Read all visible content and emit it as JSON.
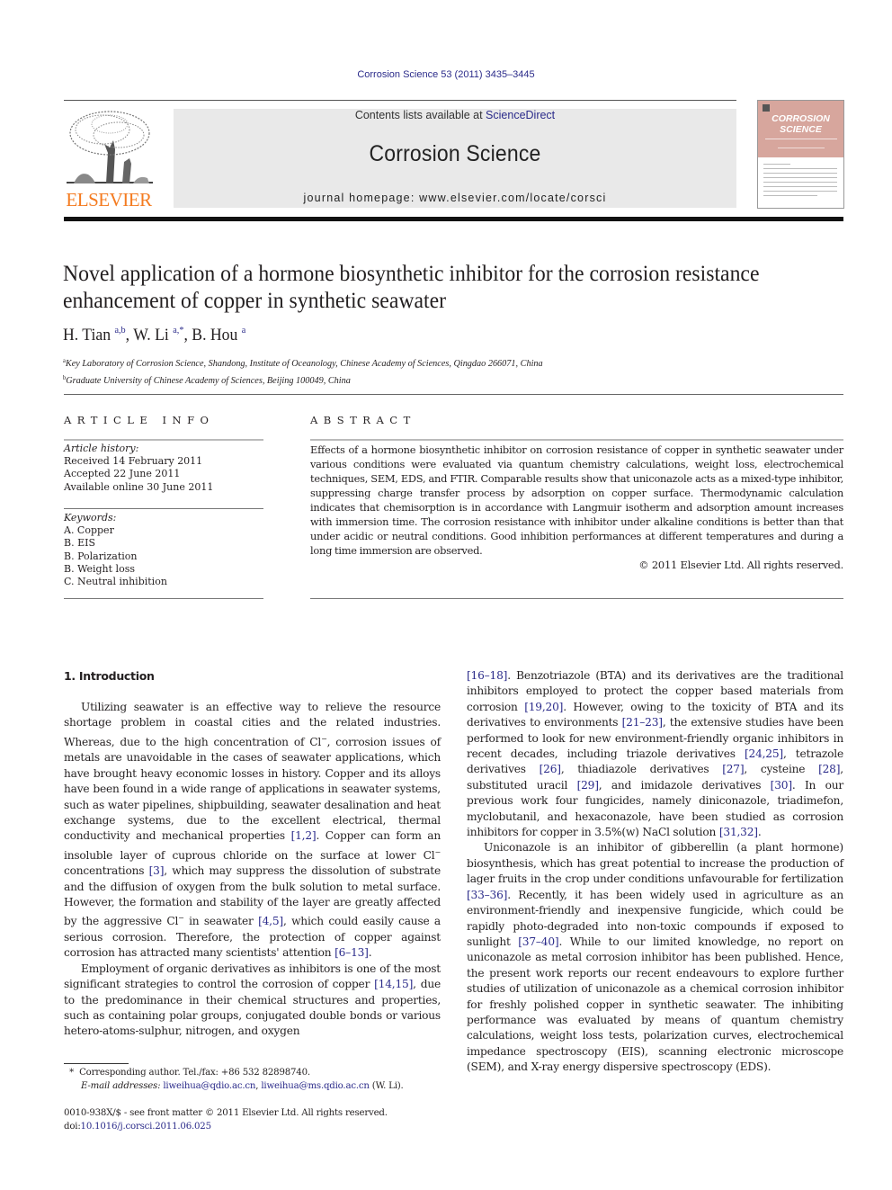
{
  "header": {
    "journal_reference": "Corrosion Science 53 (2011) 3435–3445",
    "contents_prefix": "Contents lists available at ",
    "contents_link": "ScienceDirect",
    "journal_title": "Corrosion Science",
    "homepage_prefix": "journal homepage: ",
    "homepage_url": "www.elsevier.com/locate/corsci",
    "publisher_wordmark": "ELSEVIER",
    "cover_title_line1": "CORROSION",
    "cover_title_line2": "SCIENCE",
    "colors": {
      "link": "#2b2b8a",
      "elsevier_orange": "#f47b20",
      "cover_pink": "#d7a69d",
      "masthead_gray": "#e9e9e9"
    }
  },
  "article": {
    "title": "Novel application of a hormone biosynthetic inhibitor for the corrosion resistance enhancement of copper in synthetic seawater",
    "authors": [
      {
        "name": "H. Tian",
        "sup": "a,b",
        "sep": ", "
      },
      {
        "name": "W. Li",
        "sup": "a,*",
        "sep": ", "
      },
      {
        "name": "B. Hou",
        "sup": "a",
        "sep": ""
      }
    ],
    "affiliations": [
      {
        "mark": "a",
        "text": "Key Laboratory of Corrosion Science, Shandong, Institute of Oceanology, Chinese Academy of Sciences, Qingdao 266071, China"
      },
      {
        "mark": "b",
        "text": "Graduate University of Chinese Academy of Sciences, Beijing 100049, China"
      }
    ]
  },
  "article_info": {
    "heading": "ARTICLE INFO",
    "history_label": "Article history:",
    "history": [
      "Received 14 February 2011",
      "Accepted 22 June 2011",
      "Available online 30 June 2011"
    ],
    "keywords_label": "Keywords:",
    "keywords": [
      "A. Copper",
      "B. EIS",
      "B. Polarization",
      "B. Weight loss",
      "C. Neutral inhibition"
    ]
  },
  "abstract": {
    "heading": "ABSTRACT",
    "text": "Effects of a hormone biosynthetic inhibitor on corrosion resistance of copper in synthetic seawater under various conditions were evaluated via quantum chemistry calculations, weight loss, electrochemical techniques, SEM, EDS, and FTIR. Comparable results show that uniconazole acts as a mixed-type inhibitor, suppressing charge transfer process by adsorption on copper surface. Thermodynamic calculation indicates that chemisorption is in accordance with Langmuir isotherm and adsorption amount increases with immersion time. The corrosion resistance with inhibitor under alkaline conditions is better than that under acidic or neutral conditions. Good inhibition performances at different temperatures and during a long time immersion are observed.",
    "copyright": "© 2011 Elsevier Ltd. All rights reserved."
  },
  "body": {
    "section_heading": "1. Introduction",
    "left_paragraphs": [
      [
        {
          "t": "Utilizing seawater is an effective way to relieve the resource shortage problem in coastal cities and the related industries. Whereas, due to the high concentration of Cl"
        },
        {
          "sup": "−"
        },
        {
          "t": ", corrosion issues of metals are unavoidable in the cases of seawater applications, which have brought heavy economic losses in history. Copper and its alloys have been found in a wide range of applications in seawater systems, such as water pipelines, shipbuilding, seawater desalination and heat exchange systems, due to the excellent electrical, thermal conductivity and mechanical properties "
        },
        {
          "cite": "[1,2]"
        },
        {
          "t": ". Copper can form an insoluble layer of cuprous chloride on the surface at lower Cl"
        },
        {
          "sup": "−"
        },
        {
          "t": " concentrations "
        },
        {
          "cite": "[3]"
        },
        {
          "t": ", which may suppress the dissolution of substrate and the diffusion of oxygen from the bulk solution to metal surface. However, the formation and stability of the layer are greatly affected by the aggressive Cl"
        },
        {
          "sup": "−"
        },
        {
          "t": " in seawater "
        },
        {
          "cite": "[4,5]"
        },
        {
          "t": ", which could easily cause a serious corrosion. Therefore, the protection of copper against corrosion has attracted many scientists' attention "
        },
        {
          "cite": "[6–13]"
        },
        {
          "t": "."
        }
      ],
      [
        {
          "t": "Employment of organic derivatives as inhibitors is one of the most significant strategies to control the corrosion of copper "
        },
        {
          "cite": "[14,15]"
        },
        {
          "t": ", due to the predominance in their chemical structures and properties, such as containing polar groups, conjugated double bonds or various hetero-atoms-sulphur, nitrogen, and oxygen"
        }
      ]
    ],
    "right_paragraphs": [
      [
        {
          "cite": "[16–18]"
        },
        {
          "t": ". Benzotriazole (BTA) and its derivatives are the traditional inhibitors employed to protect the copper based materials from corrosion "
        },
        {
          "cite": "[19,20]"
        },
        {
          "t": ". However, owing to the toxicity of BTA and its derivatives to environments "
        },
        {
          "cite": "[21–23]"
        },
        {
          "t": ", the extensive studies have been performed to look for new environment-friendly organic inhibitors in recent decades, including triazole derivatives "
        },
        {
          "cite": "[24,25]"
        },
        {
          "t": ", tetrazole derivatives "
        },
        {
          "cite": "[26]"
        },
        {
          "t": ", thiadiazole derivatives "
        },
        {
          "cite": "[27]"
        },
        {
          "t": ", cysteine "
        },
        {
          "cite": "[28]"
        },
        {
          "t": ", substituted uracil "
        },
        {
          "cite": "[29]"
        },
        {
          "t": ", and imidazole derivatives "
        },
        {
          "cite": "[30]"
        },
        {
          "t": ". In our previous work four fungicides, namely diniconazole, triadimefon, myclobutanil, and hexaconazole, have been studied as corrosion inhibitors for copper in 3.5%(w) NaCl solution "
        },
        {
          "cite": "[31,32]"
        },
        {
          "t": "."
        }
      ],
      [
        {
          "t": "Uniconazole is an inhibitor of gibberellin (a plant hormone) biosynthesis, which has great potential to increase the production of lager fruits in the crop under conditions unfavourable for fertilization "
        },
        {
          "cite": "[33–36]"
        },
        {
          "t": ". Recently, it has been widely used in agriculture as an environment-friendly and inexpensive fungicide, which could be rapidly photo-degraded into non-toxic compounds if exposed to sunlight "
        },
        {
          "cite": "[37–40]"
        },
        {
          "t": ". While to our limited knowledge, no report on uniconazole as metal corrosion inhibitor has been published. Hence, the present work reports our recent endeavours to explore further studies of utilization of uniconazole as a chemical corrosion inhibitor for freshly polished copper in synthetic seawater. The inhibiting performance was evaluated by means of quantum chemistry calculations, weight loss tests, polarization curves, electrochemical impedance spectroscopy (EIS), scanning electronic microscope (SEM), and X-ray energy dispersive spectroscopy (EDS)."
        }
      ]
    ]
  },
  "footnotes": {
    "corresponding": "Corresponding author. Tel./fax: +86 532 82898740.",
    "email_label": "E-mail addresses:",
    "email_1": "liweihua@qdio.ac.cn",
    "email_2": "liweihua@ms.qdio.ac.cn",
    "email_suffix": " (W. Li).",
    "issn_line": "0010-938X/$ - see front matter © 2011 Elsevier Ltd. All rights reserved.",
    "doi_prefix": "doi:",
    "doi": "10.1016/j.corsci.2011.06.025"
  }
}
